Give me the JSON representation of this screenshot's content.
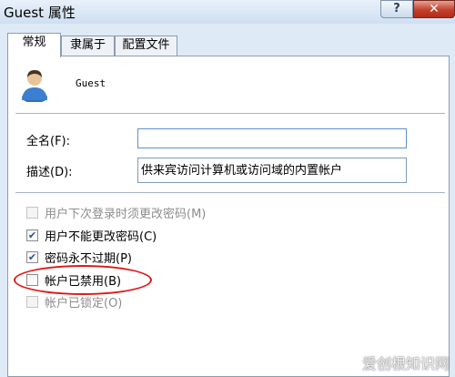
{
  "window": {
    "title": "Guest 属性",
    "help_glyph": "?",
    "close_glyph": "✕"
  },
  "tabs": [
    {
      "label": "常规",
      "active": true
    },
    {
      "label": "隶属于",
      "active": false
    },
    {
      "label": "配置文件",
      "active": false
    }
  ],
  "user": {
    "name": "Guest",
    "avatar_icon": "user-account-icon"
  },
  "fields": {
    "full_name_label": "全名(F):",
    "full_name_value": "",
    "description_label": "描述(D):",
    "description_value": "供来宾访问计算机或访问域的内置帐户"
  },
  "checkboxes": [
    {
      "label": "用户下次登录时须更改密码(M)",
      "checked": false,
      "enabled": false
    },
    {
      "label": "用户不能更改密码(C)",
      "checked": true,
      "enabled": true
    },
    {
      "label": "密码永不过期(P)",
      "checked": true,
      "enabled": true
    },
    {
      "label": "帐户已禁用(B)",
      "checked": false,
      "enabled": true,
      "highlighted": true
    },
    {
      "label": "帐户已锁定(O)",
      "checked": false,
      "enabled": false
    }
  ],
  "check_glyph": "✔",
  "colors": {
    "highlight": "#e01818",
    "focus_border": "#7f9db9",
    "disabled_text": "#8d8d8d"
  },
  "watermark": "爱创根知识网"
}
